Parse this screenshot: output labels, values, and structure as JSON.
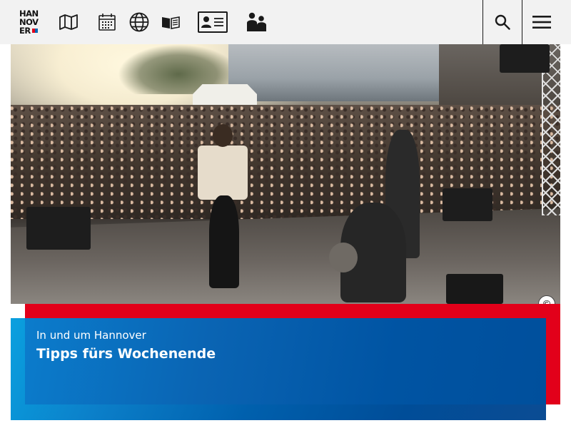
{
  "header": {
    "logo_lines": [
      "HAN",
      "NOV",
      "ER"
    ],
    "icons": [
      "map-icon",
      "calendar-icon",
      "globe-icon",
      "book-icon",
      "id-card-icon",
      "people-icon"
    ],
    "search_icon": "search-icon",
    "menu_icon": "hamburger-menu-icon"
  },
  "hero": {
    "copyright_symbol": "©"
  },
  "teaser": {
    "kicker": "In und um Hannover",
    "title": "Tipps fürs Wochenende"
  },
  "colors": {
    "header_bg": "#f2f2f2",
    "accent_red": "#e2001a",
    "accent_blue": "#0060ad",
    "light_blue": "#0aa0df"
  }
}
